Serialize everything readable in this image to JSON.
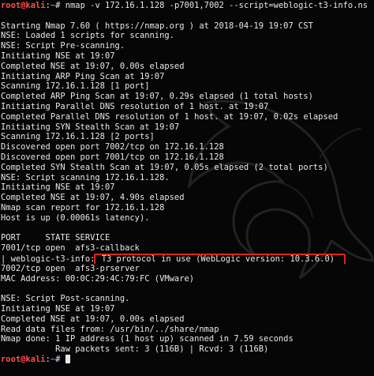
{
  "terminal": {
    "prompt_user": "root@kali",
    "prompt_sep": ":",
    "prompt_path": "~",
    "prompt_symbol": "# ",
    "command": "nmap -v 172.16.1.128 -p7001,7002 --script=weblogic-t3-info.ns",
    "output": [
      "",
      "Starting Nmap 7.60 ( https://nmap.org ) at 2018-04-19 19:07 CST",
      "NSE: Loaded 1 scripts for scanning.",
      "NSE: Script Pre-scanning.",
      "Initiating NSE at 19:07",
      "Completed NSE at 19:07, 0.00s elapsed",
      "Initiating ARP Ping Scan at 19:07",
      "Scanning 172.16.1.128 [1 port]",
      "Completed ARP Ping Scan at 19:07, 0.29s elapsed (1 total hosts)",
      "Initiating Parallel DNS resolution of 1 host. at 19:07",
      "Completed Parallel DNS resolution of 1 host. at 19:07, 0.02s elapsed",
      "Initiating SYN Stealth Scan at 19:07",
      "Scanning 172.16.1.128 [2 ports]",
      "Discovered open port 7002/tcp on 172.16.1.128",
      "Discovered open port 7001/tcp on 172.16.1.128",
      "Completed SYN Stealth Scan at 19:07, 0.05s elapsed (2 total ports)",
      "NSE: Script scanning 172.16.1.128.",
      "Initiating NSE at 19:07",
      "Completed NSE at 19:07, 4.90s elapsed",
      "Nmap scan report for 172.16.1.128",
      "Host is up (0.00061s latency).",
      "",
      "PORT     STATE SERVICE",
      "7001/tcp open  afs3-callback"
    ],
    "script_line_prefix": "| weblogic-t3-info:",
    "script_line_highlight": " T3 protocol in use (WebLogic version: 10.3.6.0)",
    "output_after": [
      "7002/tcp open  afs3-prserver",
      "MAC Address: 00:0C:29:4C:79:FC (VMware)",
      "",
      "NSE: Script Post-scanning.",
      "Initiating NSE at 19:07",
      "Completed NSE at 19:07, 0.00s elapsed",
      "Read data files from: /usr/bin/../share/nmap",
      "Nmap done: 1 IP address (1 host up) scanned in 7.59 seconds",
      "           Raw packets sent: 3 (116B) | Rcvd: 3 (116B)"
    ]
  },
  "colors": {
    "background": "#060606",
    "text": "#e8e8e8",
    "prompt_user": "#ff4d4d",
    "prompt_path": "#5a8cff",
    "highlight_border": "#e0241b"
  },
  "icons": {
    "background_logo": "kali-dragon-icon"
  }
}
